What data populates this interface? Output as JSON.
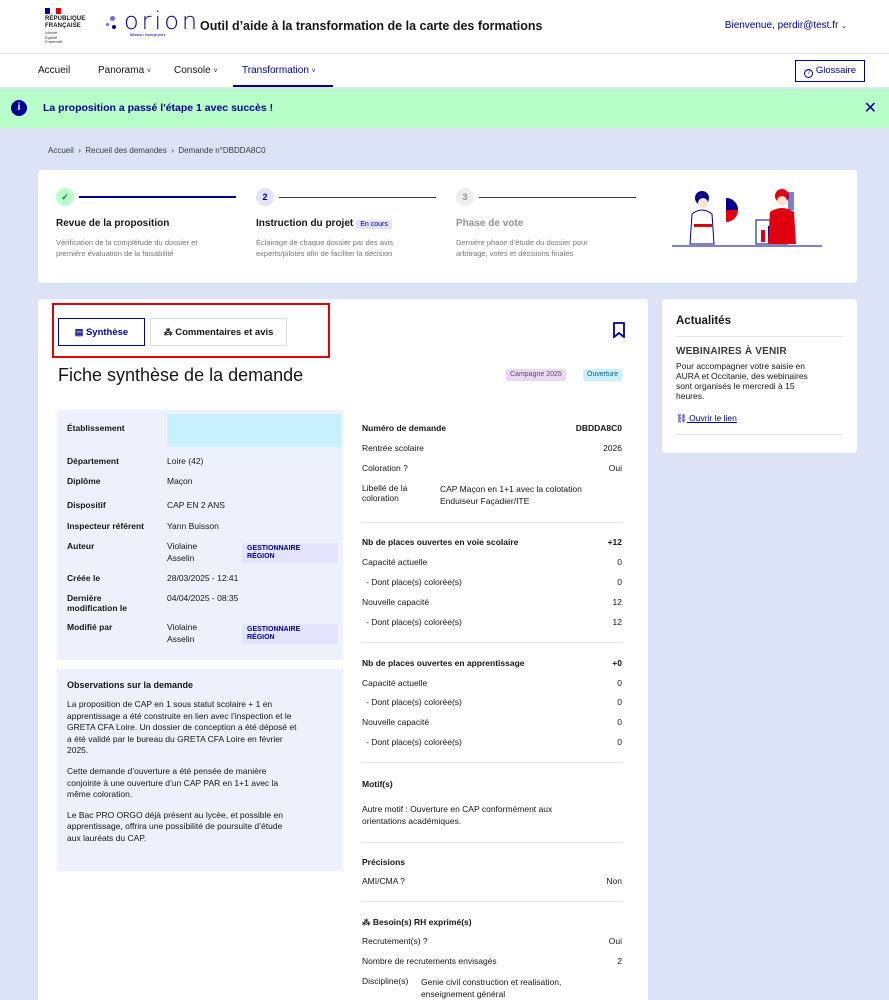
{
  "header": {
    "gov_logo_text": [
      "RÉPUBLIQUE",
      "FRANÇAISE"
    ],
    "gov_motto": [
      "Liberté",
      "Égalité",
      "Fraternité"
    ],
    "app_logo_word": "orion",
    "app_logo_sub": "Mission Inserjeunes",
    "app_title": "Outil d’aide à la transformation de la carte des formations",
    "welcome": "Bienvenue, perdir@test.fr",
    "welcome_icon": "chevron-down-icon"
  },
  "nav": {
    "items": [
      {
        "label": "Accueil"
      },
      {
        "label": "Panorama"
      },
      {
        "label": "Console"
      },
      {
        "label": "Transformation"
      }
    ],
    "glossaire": "Glossaire"
  },
  "alert": {
    "message": "La proposition a passé l'étape 1 avec succès !",
    "icon": "info-icon",
    "close_icon": "close-icon",
    "color": "#b8fec9"
  },
  "breadcrumb": {
    "items": [
      "Accueil",
      "Recueil des demandes",
      "Demande n°DBDDA8C0"
    ]
  },
  "stepper": {
    "steps": [
      {
        "num": "",
        "title": "Revue de la proposition",
        "desc1": "Vérification de la complétude du dossier et",
        "desc2": "première évaluation de la faisabilité"
      },
      {
        "num": "2",
        "title": "Instruction du projet",
        "badge": "En cours",
        "desc1": "Éclairage de chaque dossier par des avis",
        "desc2": "experts/pilotes afin de faciliter la décision"
      },
      {
        "num": "3",
        "title": "Phase de vote",
        "desc1": "Dernière phase d’étude du dossier pour",
        "desc2": "arbitrage, votes et décisions finales"
      }
    ]
  },
  "tabs": {
    "synthese": "Synthèse",
    "commentaires": "Commentaires et avis"
  },
  "fiche": {
    "title": "Fiche synthèse de la demande",
    "tag_campagne": "Campagne 2025",
    "tag_ouverture": "Ouverture"
  },
  "info": {
    "etablissement_label": "Établissement",
    "departement_label": "Département",
    "departement": "Loire (42)",
    "diplome_label": "Diplôme",
    "diplome": "Maçon",
    "dispositif_label": "Dispositif",
    "dispositif": "CAP EN 2 ANS",
    "inspecteur_label": "Inspecteur référent",
    "inspecteur": "Yann Buisson",
    "auteur_label": "Auteur",
    "auteur_1": "Violaine",
    "auteur_2": "Asselin",
    "role_1": "GESTIONNAIRE",
    "role_2": "RÉGION",
    "creee_label": "Créée le",
    "creee": "28/03/2025 - 12:41",
    "modif_label_1": "Dernière",
    "modif_label_2": "modification le",
    "modif": "04/04/2025 - 08:35",
    "modifie_par_label": "Modifié par",
    "modifie_par_1": "Violaine",
    "modifie_par_2": "Asselin"
  },
  "observations": {
    "heading": "Observations sur la demande",
    "p1_lines": [
      "La proposition de CAP en 1 sous statut scolaire + 1 en",
      "apprentissage a été construite en lien avec l’inspection et le",
      "GRETA CFA Loire. Un dossier de conception a été déposé et",
      "a été validé par le bureau du GRETA CFA Loire en février",
      "2025."
    ],
    "p2_lines": [
      "Cette demande d’ouverture a été pensée de manière",
      "conjointe à une ouverture d’un CAP PAR en 1+1 avec la",
      "même coloration."
    ],
    "p3_lines": [
      "Le Bac PRO ORGO déjà présent au lycée, et possible en",
      "apprentissage, offrira une possibilité de poursuite d’étude",
      "aux lauréats du CAP."
    ]
  },
  "details": {
    "numero_label": "Numéro de demande",
    "numero": "DBDDA8C0",
    "rentree_label": "Rentrée scolaire",
    "rentree": "2026",
    "coloration_label": "Coloration ?",
    "coloration": "Oui",
    "libelle_label_1": "Libellé de la",
    "libelle_label_2": "coloration",
    "libelle_1": "CAP Maçon en 1+1 avec la colotation",
    "libelle_2": "Enduiseur Façadier/ITE",
    "voie_label": "Nb de places ouvertes en voie scolaire",
    "voie": "+12",
    "cap_act_label": "Capacité actuelle",
    "cap_act": "0",
    "dont_col_label": "- Dont place(s) colorée(s)",
    "dont_col_1": "0",
    "nouv_cap_label": "Nouvelle capacité",
    "nouv_cap": "12",
    "dont_col_2": "12",
    "app_label": "Nb de places ouvertes en apprentissage",
    "app": "+0",
    "cap_act_app": "0",
    "dont_col_app_1": "0",
    "nouv_cap_app": "0",
    "dont_col_app_2": "0",
    "motif_label": "Motif(s)",
    "motif_1": "Autre motif : Ouverture en CAP conformément aux",
    "motif_2": "orientations académiques.",
    "precisions_label": "Précisions",
    "ami_label": "AMI/CMA ?",
    "ami": "Non",
    "rh_label": "Besoin(s) RH exprimé(s)",
    "recrut_label": "Recrutement(s) ?",
    "recrut": "Oui",
    "nb_recrut_label": "Nombre de recrutements envisagés",
    "nb_recrut": "2",
    "discipline_label": "Discipline(s)",
    "discipline_1": "Genie civil construction et realisation,",
    "discipline_2": "enseignement général"
  },
  "sidebar": {
    "title": "Actualités",
    "subtitle": "WEBINAIRES À VENIR",
    "text_lines": [
      "Pour accompagner votre saisie en",
      "AURA et Occitanie, des webinaires",
      "sont organisés le mercredi à 15",
      "heures."
    ],
    "link": "Ouvrir le lien"
  }
}
